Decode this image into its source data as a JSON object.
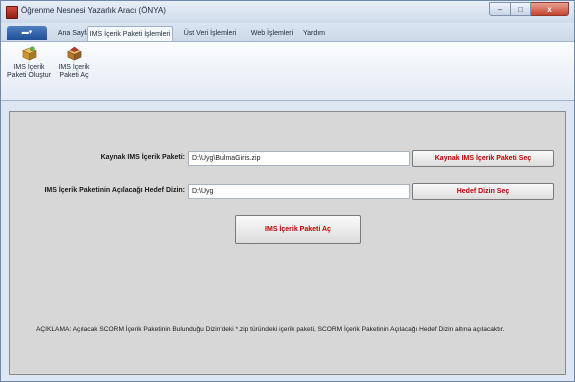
{
  "window": {
    "title": "Öğrenme Nesnesi Yazarlık Aracı (ÖNYA)",
    "minimize_glyph": "–",
    "maximize_glyph": "□",
    "close_glyph": "x"
  },
  "tabs": [
    {
      "label": "Ana Sayfa",
      "active": false
    },
    {
      "label": "IMS İçerik Paketi İşlemleri",
      "active": true
    },
    {
      "label": "Üst Veri İşlemleri",
      "active": false
    },
    {
      "label": "Web İşlemleri",
      "active": false
    },
    {
      "label": "Yardım",
      "active": false
    }
  ],
  "ribbon": {
    "create_package": {
      "line1": "IMS İçerik",
      "line2": "Paketi Oluştur",
      "icon": "package-box-icon"
    },
    "open_package": {
      "line1": "IMS İçerik",
      "line2": "Paketi Aç",
      "icon": "package-open-icon"
    }
  },
  "form": {
    "source_label": "Kaynak IMS İçerik Paketi:",
    "source_value": "D:\\Uyg\\BulmaGiris.zip",
    "source_button": "Kaynak IMS İçerik Paketi Seç",
    "target_label": "IMS İçerik Paketinin Açılacağı Hedef Dizin:",
    "target_value": "D:\\Uyg",
    "target_button": "Hedef Dizin Seç",
    "open_button": "IMS İçerik Paketi Aç"
  },
  "note": "AÇIKLAMA: Açılacak SCORM İçerik Paketinin Bulunduğu Dizin'deki *.zip türündeki içerik paketi, SCORM İçerik Paketinin Açılacağı Hedef Dizin altına açılacaktır.",
  "colors": {
    "button_text": "#c00000",
    "panel_bg": "#d7d7d7",
    "app_menu": "#1e4f95"
  }
}
